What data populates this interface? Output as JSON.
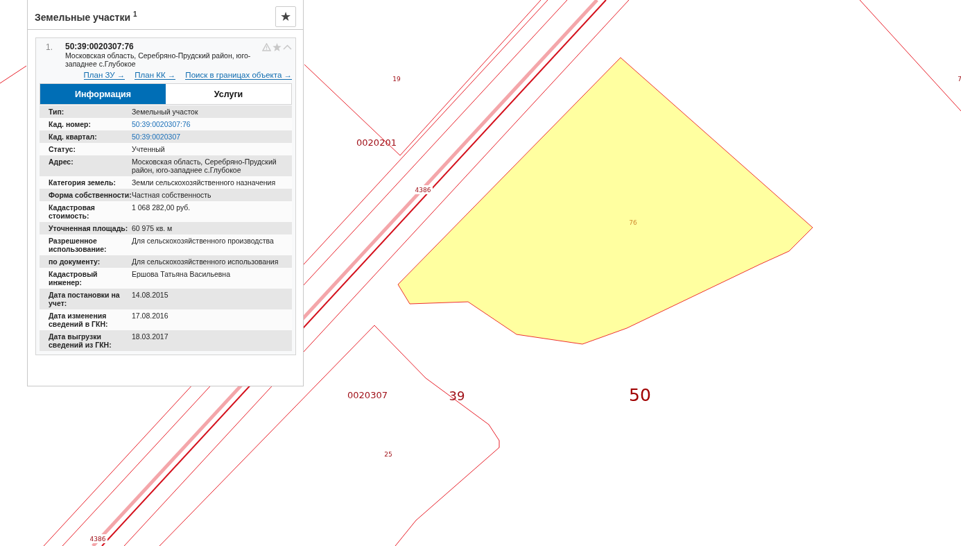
{
  "map": {
    "labels": [
      {
        "text": "19",
        "kind": "small"
      },
      {
        "text": "0020201",
        "kind": "quarter"
      },
      {
        "text": "4386",
        "kind": "road"
      },
      {
        "text": "76",
        "kind": "parcel"
      },
      {
        "text": "0020307",
        "kind": "quarter"
      },
      {
        "text": "39",
        "kind": "district"
      },
      {
        "text": "50",
        "kind": "region"
      },
      {
        "text": "25",
        "kind": "small"
      },
      {
        "text": "4386",
        "kind": "road"
      },
      {
        "text": "7",
        "kind": "small"
      }
    ]
  },
  "panel": {
    "title": "Земельные участки $^{1}$",
    "favorite_button": "★",
    "result": {
      "index": "1.",
      "number": "50:39:0020307:76",
      "address": "Московская область, Серебряно-Прудский район, юго-западнее с.Глубокое",
      "links": [
        "План ЗУ →",
        "План КК →",
        "Поиск в границах объекта →"
      ],
      "tabs": [
        {
          "label": "Информация",
          "selected": true
        },
        {
          "label": "Услуги",
          "selected": false
        }
      ],
      "rows": [
        {
          "label": "Тип:",
          "value": "Земельный участок",
          "kind": "text"
        },
        {
          "label": "Кад. номер:",
          "value": "50:39:0020307:76",
          "kind": "link"
        },
        {
          "label": "Кад. квартал:",
          "value": "50:39:0020307",
          "kind": "link"
        },
        {
          "label": "Статус:",
          "value": "Учтенный",
          "kind": "text"
        },
        {
          "label": "Адрес:",
          "value": "Московская область, Серебряно-Прудский район, юго-западнее с.Глубокое",
          "kind": "text"
        },
        {
          "label": "Категория земель:",
          "value": "Земли сельскохозяйственного назначения",
          "kind": "text"
        },
        {
          "label": "Форма собственности:",
          "value": "Частная собственность",
          "kind": "text"
        },
        {
          "label": "Кадастровая стоимость:",
          "value": "1 068 282,00 руб.",
          "kind": "text"
        },
        {
          "label": "Уточненная площадь:",
          "value": "60 975 кв. м",
          "kind": "text"
        },
        {
          "label": "Разрешенное использование:",
          "value": "Для сельскохозяйственного производства",
          "kind": "text"
        },
        {
          "label": "по документу:",
          "value": "Для сельскохозяйственного использования",
          "kind": "text"
        },
        {
          "label": "Кадастровый инженер:",
          "value": "Ершова Татьяна Васильевна",
          "kind": "text"
        },
        {
          "label": "Дата постановки на учет:",
          "value": "14.08.2015",
          "kind": "text"
        },
        {
          "label": "Дата изменения сведений в ГКН:",
          "value": "17.08.2016",
          "kind": "text"
        },
        {
          "label": "Дата выгрузки сведений из ГКН:",
          "value": "18.03.2017",
          "kind": "text"
        }
      ]
    }
  }
}
